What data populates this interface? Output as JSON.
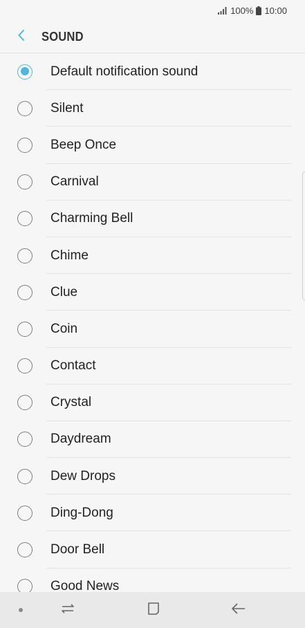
{
  "status_bar": {
    "battery": "100%",
    "time": "10:00",
    "signal_icon": "signal-icon",
    "battery_icon": "battery-icon"
  },
  "header": {
    "title": "SOUND",
    "back_icon": "chevron-left-icon"
  },
  "accent_color": "#4fb6dc",
  "sounds": {
    "selected": "Default notification sound",
    "items": [
      {
        "label": "Default notification sound",
        "selected": true
      },
      {
        "label": "Silent",
        "selected": false
      },
      {
        "label": "Beep Once",
        "selected": false
      },
      {
        "label": "Carnival",
        "selected": false
      },
      {
        "label": "Charming Bell",
        "selected": false
      },
      {
        "label": "Chime",
        "selected": false
      },
      {
        "label": "Clue",
        "selected": false
      },
      {
        "label": "Coin",
        "selected": false
      },
      {
        "label": "Contact",
        "selected": false
      },
      {
        "label": "Crystal",
        "selected": false
      },
      {
        "label": "Daydream",
        "selected": false
      },
      {
        "label": "Dew Drops",
        "selected": false
      },
      {
        "label": "Ding-Dong",
        "selected": false
      },
      {
        "label": "Door Bell",
        "selected": false
      },
      {
        "label": "Good News",
        "selected": false
      }
    ]
  },
  "nav_bar": {
    "recents_icon": "recent-apps-icon",
    "home_icon": "home-icon",
    "back_icon": "back-arrow-icon"
  }
}
